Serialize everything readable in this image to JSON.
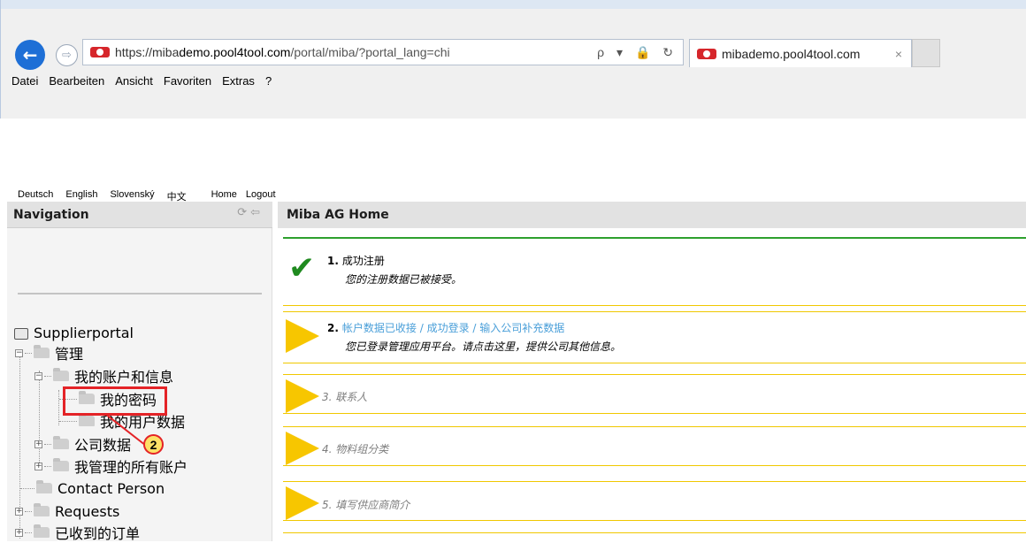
{
  "browser": {
    "url_prefix": "https://miba",
    "url_host": "demo.pool4tool.com",
    "url_path": "/portal/miba/?portal_lang=chi",
    "addr_tools": "ρ ▾ 🔒 ↻",
    "tab_title": "mibademo.pool4tool.com",
    "tab_close": "×",
    "menu": [
      "Datei",
      "Bearbeiten",
      "Ansicht",
      "Favoriten",
      "Extras",
      "?"
    ]
  },
  "langbar": {
    "langs": [
      "Deutsch",
      "English",
      "Slovenský",
      "中文"
    ],
    "home": "Home",
    "logout": "Logout"
  },
  "nav": {
    "title": "Navigation",
    "tree": [
      {
        "label": "Supplierportal"
      },
      {
        "label": "管理"
      },
      {
        "label": "我的账户和信息"
      },
      {
        "label": "我的密码"
      },
      {
        "label": "我的用户数据"
      },
      {
        "label": "公司数据"
      },
      {
        "label": "我管理的所有账户"
      },
      {
        "label": "Contact Person"
      },
      {
        "label": "Requests"
      },
      {
        "label": "已收到的订单"
      }
    ],
    "marker_number": "2"
  },
  "main": {
    "title": "Miba AG Home",
    "steps": [
      {
        "num": "1.",
        "title": "成功注册",
        "desc": "您的注册数据已被接受。"
      },
      {
        "num": "2.",
        "title": "帐户数据已收接 / 成功登录 / 输入公司补充数据",
        "desc": "您已登录管理应用平台。请点击这里，提供公司其他信息。"
      },
      {
        "title": "3. 联系人"
      },
      {
        "title": "4. 物料组分类"
      },
      {
        "title": "5. 填写供应商简介"
      }
    ]
  },
  "colors": {
    "accent_blue": "#1e6fd6",
    "highlight_red": "#e42327",
    "step_yellow": "#f7c600",
    "check_green": "#1f8a1f",
    "link_blue": "#4a9fd9"
  }
}
